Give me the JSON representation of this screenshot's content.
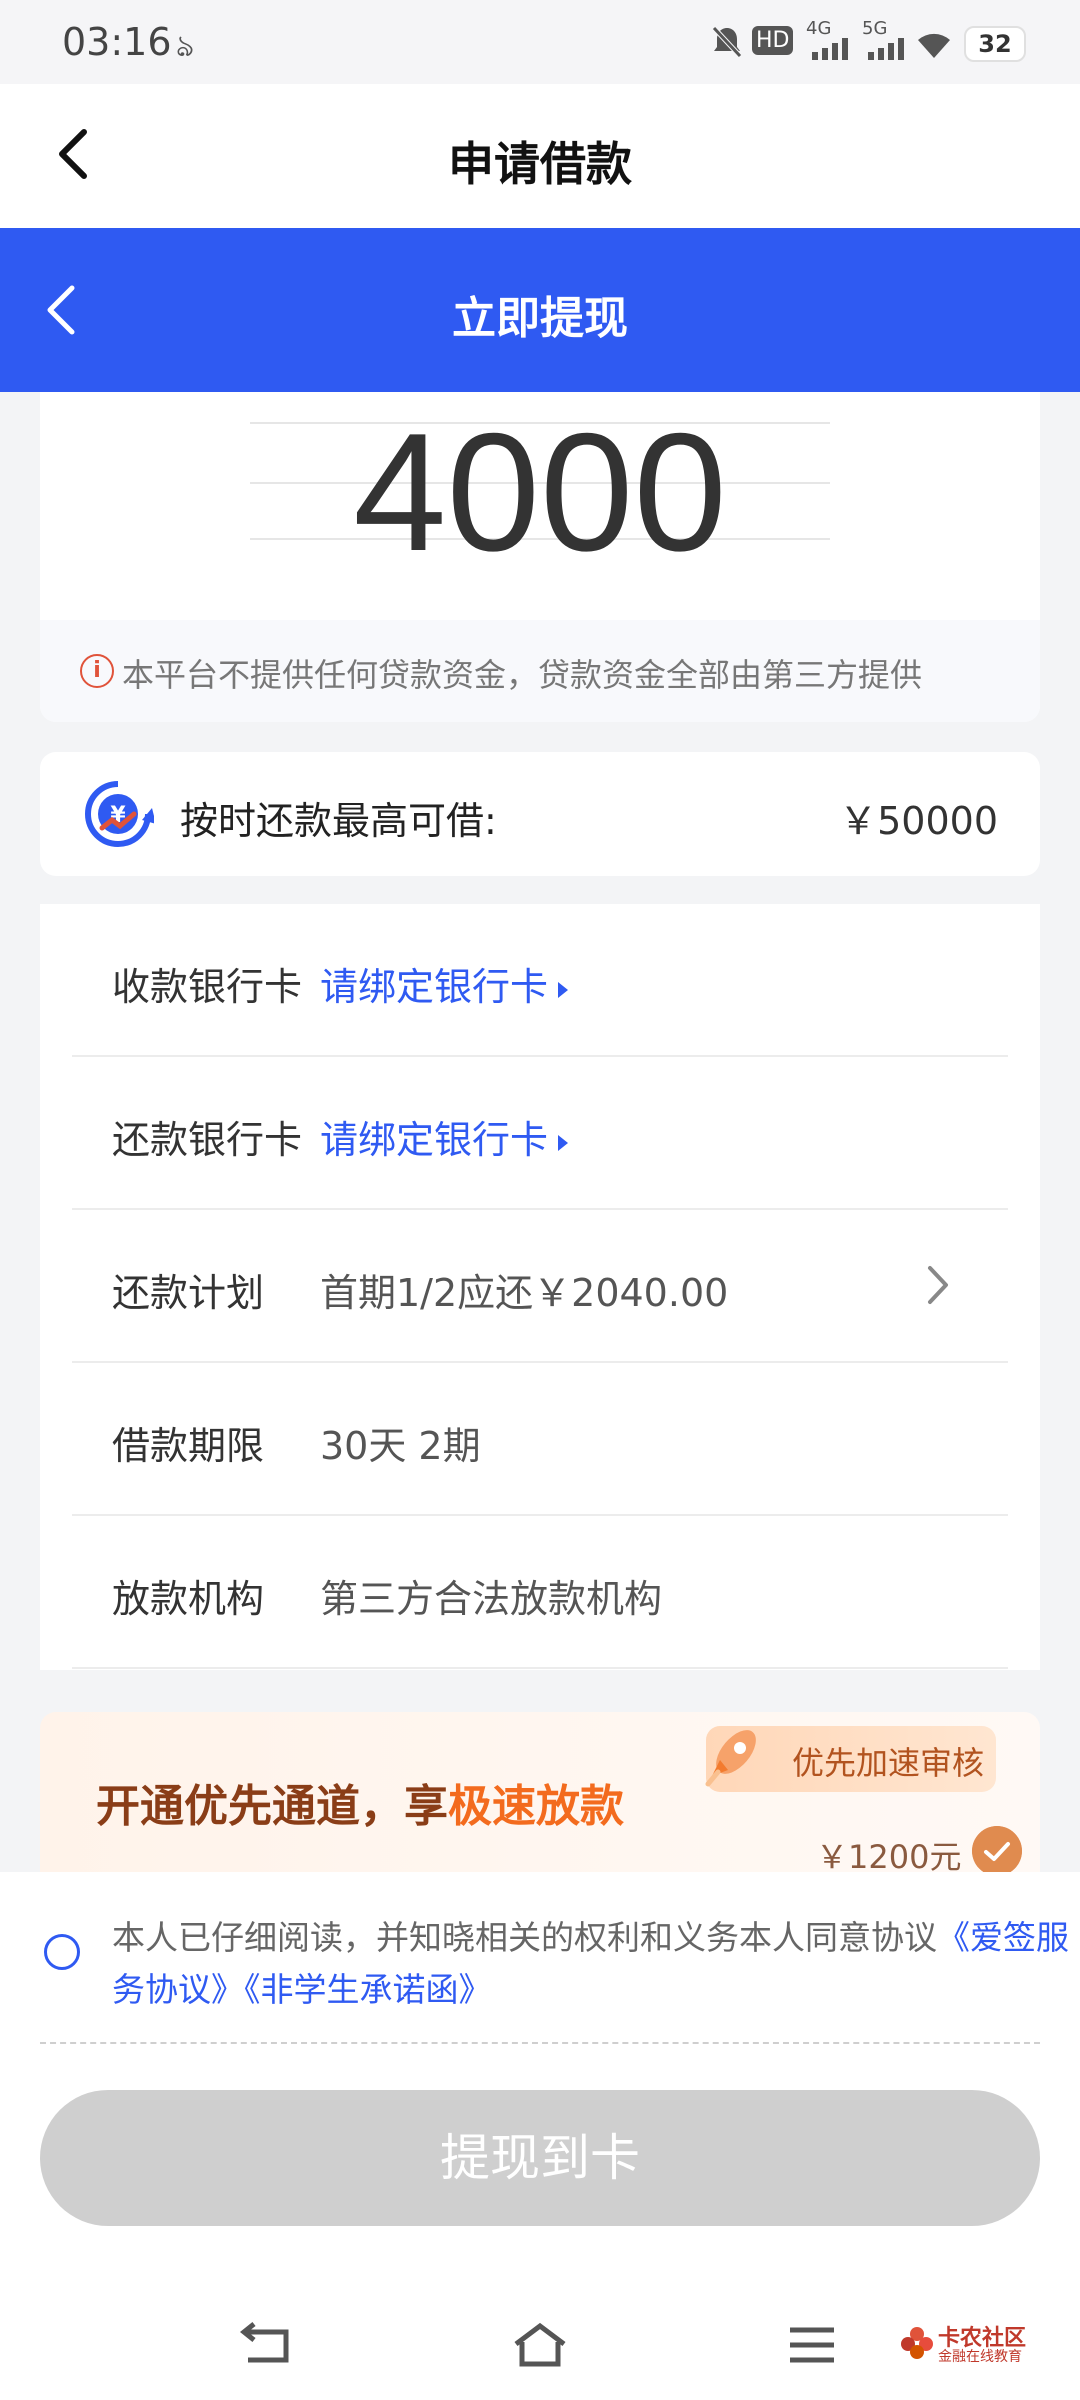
{
  "status_bar": {
    "time": "03:16",
    "battery": "32",
    "network_4g": "4G",
    "network_5g": "5G",
    "hd": "HD"
  },
  "outer_header": {
    "title": "申请借款"
  },
  "inner_header": {
    "title": "立即提现"
  },
  "amount": {
    "value": "4000",
    "notice": "本平台不提供任何贷款资金，贷款资金全部由第三方提供",
    "notice_icon": "info-icon"
  },
  "limit": {
    "label": "按时还款最高可借:",
    "value": "￥50000",
    "icon": "yen-refresh-icon"
  },
  "rows": [
    {
      "label": "收款银行卡",
      "value": "请绑定银行卡"
    },
    {
      "label": "还款银行卡",
      "value": "请绑定银行卡"
    },
    {
      "label": "还款计划",
      "value": "首期1/2应还￥2040.00"
    },
    {
      "label": "借款期限",
      "value": "30天 2期"
    },
    {
      "label": "放款机构",
      "value": "第三方合法放款机构"
    }
  ],
  "promo": {
    "headline_prefix": "开通优先通道，享",
    "headline_highlight": "极速放款",
    "badge": "优先加速审核",
    "price": "￥1200元"
  },
  "agreement": {
    "text": "本人已仔细阅读，并知晓相关的权利和义务本人同意协议",
    "link1": "《爱签服务协议》",
    "link2": "《非学生承诺函》"
  },
  "submit_label": "提现到卡",
  "watermark": {
    "name": "卡农社区",
    "sub": "金融在线教育"
  },
  "colors": {
    "primary": "#2f5af2",
    "promo_accent": "#f36b1e",
    "disabled": "#cfcfcf"
  }
}
